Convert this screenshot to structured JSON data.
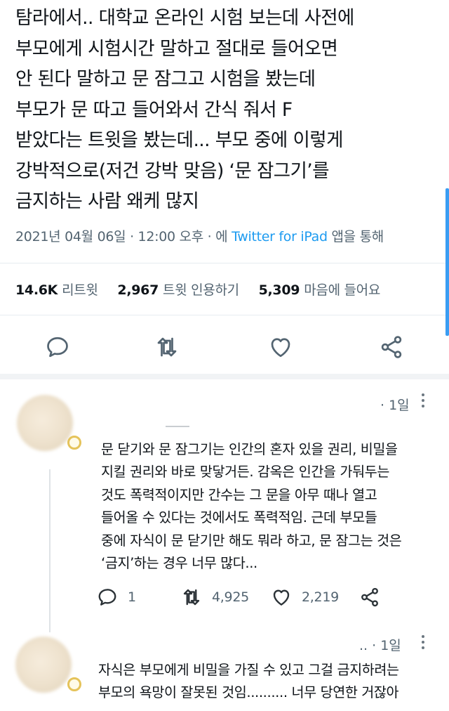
{
  "tweet": {
    "text": "탐라에서.. 대학교 온라인 시험 보는데 사전에\n부모에게 시험시간 말하고 절대로 들어오면\n안 된다 말하고 문 잠그고 시험을 봤는데\n부모가 문 따고 들어와서 간식 줘서 F\n받았다는 트윗을 봤는데... 부모 중에 이렇게\n강박적으로(저건 강박 맞음) ‘문 잠그기’를\n금지하는 사람 왜케 많지",
    "timestamp": "2021년 04월 06일 · 12:00 오후 · 에",
    "via_app": "Twitter for iPad",
    "via_suffix": "앱을 통해",
    "stats": {
      "retweets_count": "14.6K",
      "retweets_label": "리트윗",
      "quotes_count": "2,967",
      "quotes_label": "트윗 인용하기",
      "likes_count": "5,309",
      "likes_label": "마음에 들어요"
    },
    "actions": [
      "reply-icon",
      "retweet-icon",
      "heart-icon",
      "share-icon"
    ]
  },
  "replies": [
    {
      "time": "· 1일",
      "text": "문 닫기와 문 잠그기는 인간의 혼자 있을 권리, 비밀을\n지킬 권리와 바로 맞닿거든. 감옥은 인간을 가둬두는\n것도 폭력적이지만 간수는 그 문을 아무 때나 열고\n들어올 수 있다는 것에서도 폭력적임. 근데 부모들\n중에 자식이 문 닫기만 해도 뭐라 하고, 문 잠그는 것은\n‘금지’하는 경우 너무 많다...",
      "reply_count": "1",
      "retweet_count": "4,925",
      "like_count": "2,219"
    },
    {
      "time": ".. · 1일",
      "text": "자식은 부모에게 비밀을 가질 수 있고 그걸 금지하려는\n부모의 욕망이 잘못된 것임.......... 너무 당연한 거잖아"
    }
  ],
  "colors": {
    "text": "#0f1419",
    "secondary": "#536471",
    "link": "#1d9bf0",
    "divider": "#e6ecf0"
  }
}
